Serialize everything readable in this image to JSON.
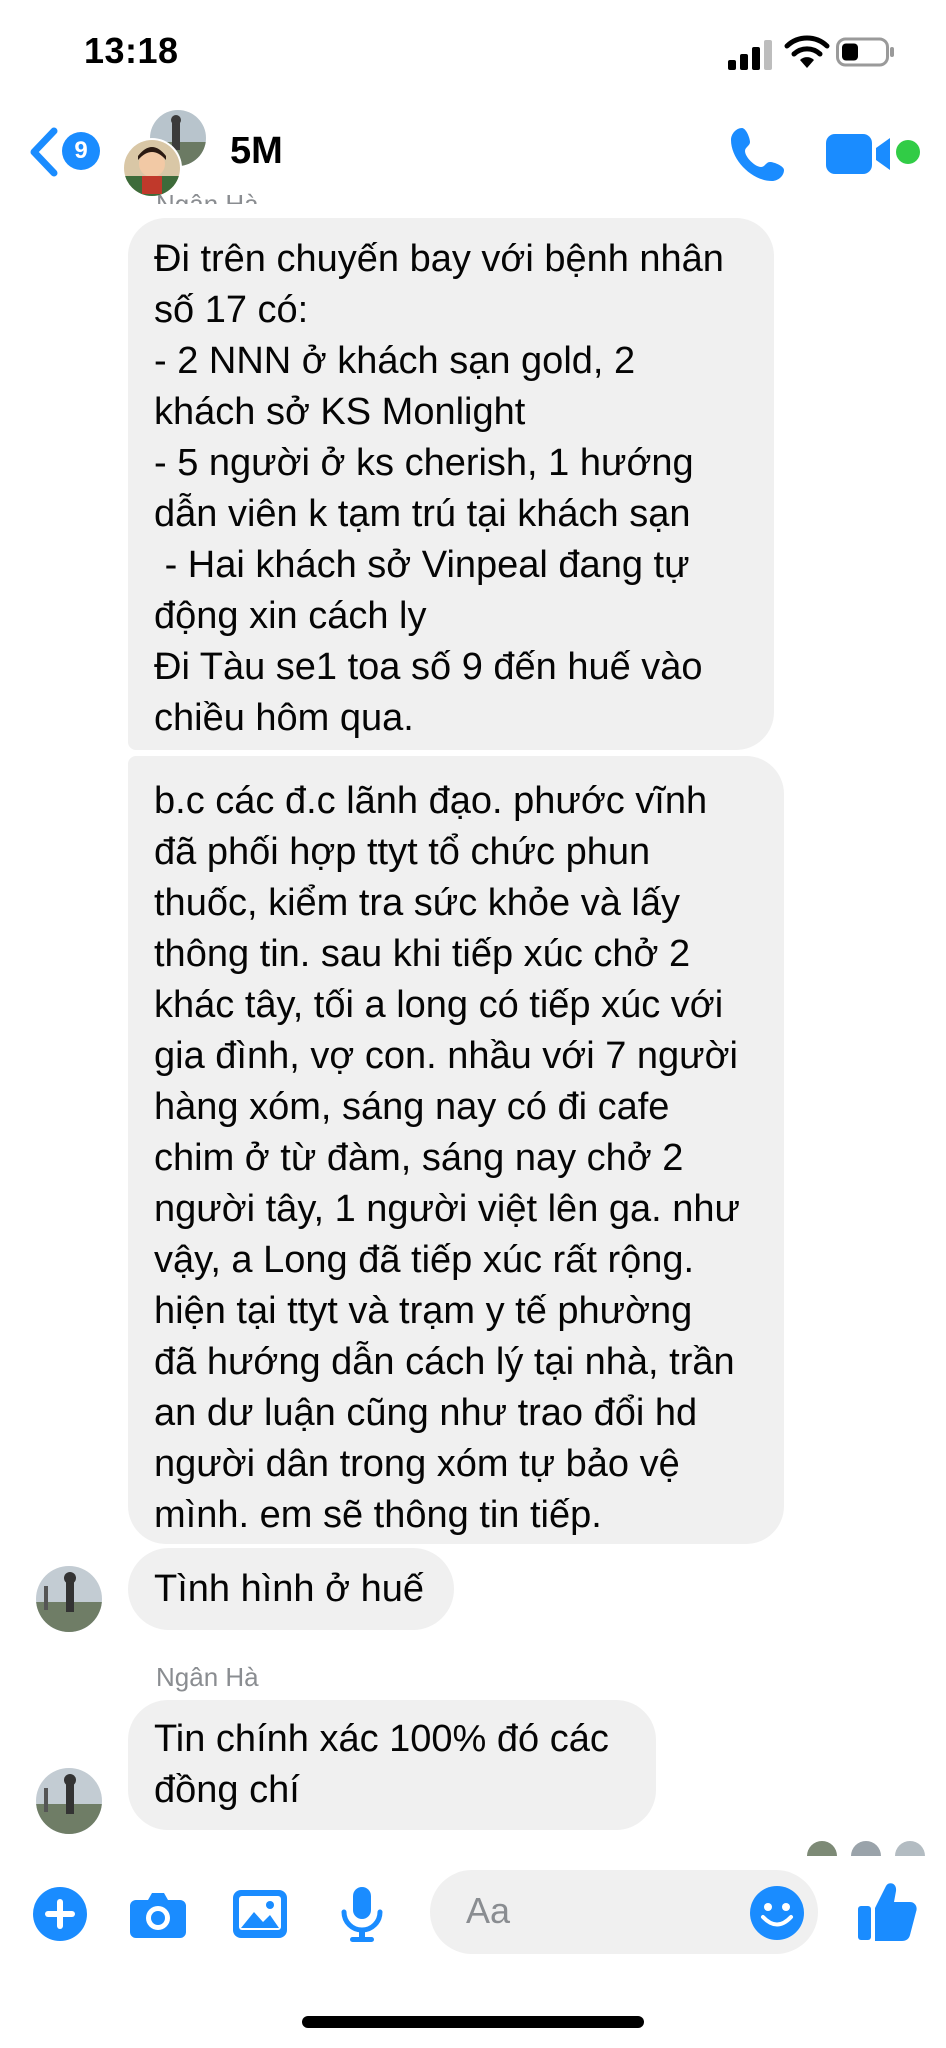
{
  "status_bar": {
    "time": "13:18"
  },
  "header": {
    "back_badge": "9",
    "group_name": "5M"
  },
  "messages": [
    {
      "sender_clipped": "Ngân Hà",
      "text": "Đi trên chuyến bay với bệnh nhân\nsố 17 có:\n- 2 NNN ở khách sạn gold, 2\nkhách sở KS Monlight\n- 5 người ở ks cherish, 1 hướng\ndẫn viên k tạm trú tại khách sạn\n - Hai khách sở Vinpeal đang tự\nđộng xin cách ly\nĐi Tàu se1 toa số 9 đến huế vào\nchiều hôm qua."
    },
    {
      "text": "b.c các đ.c lãnh đạo. phước vĩnh\nđã phối hợp ttyt tổ chức phun\nthuốc, kiểm tra sức khỏe và lấy\nthông tin. sau khi tiếp xúc chở 2\nkhác tây, tối a long có tiếp xúc với\ngia đình, vợ con. nhầu với 7 người\nhàng xóm, sáng nay có đi cafe\nchim ở từ đàm, sáng nay chở 2\nngười tây, 1 người việt lên ga. như\nvậy, a Long đã tiếp xúc rất rộng.\nhiện tại ttyt và trạm y tế phường\nđã hướng dẫn cách lý tại nhà, trần\nan dư luận cũng như trao đổi hd\nngười dân trong xóm tự bảo vệ\nmình. em sẽ thông tin tiếp."
    },
    {
      "text": "Tình hình ở huế"
    },
    {
      "sender": "Ngân Hà",
      "text": "Tin chính xác 100% đó các\nđồng chí"
    }
  ],
  "composer": {
    "placeholder": "Aa"
  },
  "colors": {
    "accent": "#1a8cff",
    "bubble": "#f0f0f0",
    "online": "#31cc46",
    "secondary_text": "#8a8d91"
  },
  "icons": [
    "back-chevron-icon",
    "phone-icon",
    "video-camera-icon",
    "plus-icon",
    "camera-icon",
    "photo-icon",
    "microphone-icon",
    "emoji-icon",
    "thumbs-up-icon"
  ]
}
